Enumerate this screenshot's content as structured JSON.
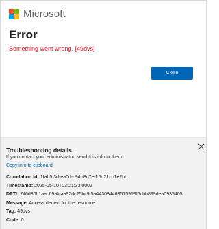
{
  "header": {
    "brand": "Microsoft",
    "logo_colors": [
      "#f25022",
      "#7fba00",
      "#00a4ef",
      "#ffb900"
    ]
  },
  "main": {
    "title": "Error",
    "message": "Something went wrong. [49dvs]",
    "close_label": "Close"
  },
  "details": {
    "title": "Troubleshooting details",
    "subtitle": "If you contact your administrator, send this info to them.",
    "copy_label": "Copy info to clipboard",
    "close_icon": "close-icon",
    "rows": [
      {
        "key": "Correlation Id:",
        "value": "1fab5f3d-ea0d-c94f-8d7e-16d21cb1e2bb"
      },
      {
        "key": "Timestamp:",
        "value": "2025-05-10T03:21:33.000Z"
      },
      {
        "key": "DPTI:",
        "value": "746d80ff1aac69afcaa92dc25bc9f5a443084463575919f6cbb899dea0935405"
      },
      {
        "key": "Message:",
        "value": "Access denied for the resource."
      },
      {
        "key": "Tag:",
        "value": "49dvs"
      },
      {
        "key": "Code:",
        "value": "0"
      }
    ]
  },
  "colors": {
    "accent": "#0067b8",
    "error": "#e81123",
    "panel": "#f2f2f2"
  }
}
